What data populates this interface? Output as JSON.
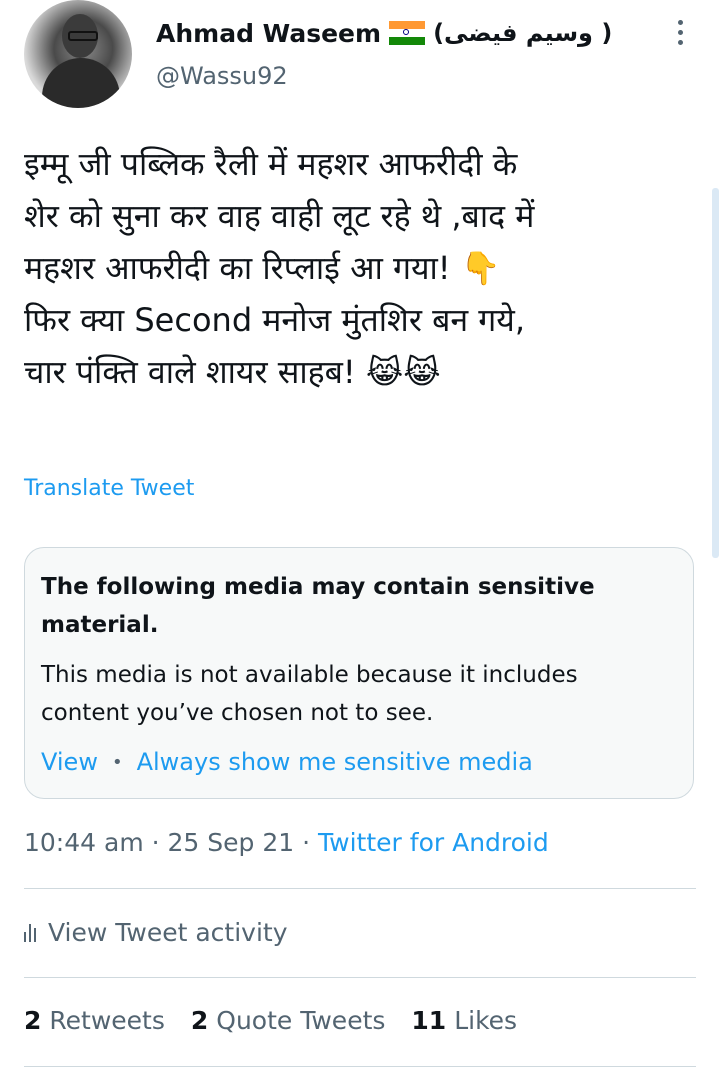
{
  "author": {
    "name": "Ahmad Waseem",
    "urdu_name": "( وسیم فیضی)",
    "handle": "@Wassu92"
  },
  "tweet": {
    "lines": [
      "इम्मू जी पब्लिक रैली में महशर आफरीदी के",
      "शेर को सुना कर वाह वाही लूट रहे थे ,बाद में",
      "महशर आफरीदी का रिप्लाई आ गया! 👇",
      "फिर क्या Second मनोज मुंतशिर बन गये,",
      "चार पंक्ति वाले शायर साहब! 😹😹"
    ],
    "translate_label": "Translate Tweet"
  },
  "sensitive_card": {
    "title": "The following media may contain sensitive material.",
    "body": "This media is not available because it includes content you’ve chosen not to see.",
    "view_label": "View",
    "separator": "•",
    "always_show_label": "Always show me sensitive media"
  },
  "meta": {
    "time": "10:44 am",
    "date": "25 Sep 21",
    "source": "Twitter for Android",
    "separator": "·"
  },
  "activity": {
    "label": "View Tweet activity",
    "icon": "bar-chart-icon"
  },
  "stats": {
    "retweets_count": "2",
    "retweets_label": "Retweets",
    "quotes_count": "2",
    "quotes_label": "Quote Tweets",
    "likes_count": "11",
    "likes_label": "Likes"
  },
  "colors": {
    "accent": "#1d9bf0",
    "secondary_text": "#536471",
    "primary_text": "#0f1419",
    "border": "#cfd9de",
    "card_bg": "#f7f9f9"
  }
}
